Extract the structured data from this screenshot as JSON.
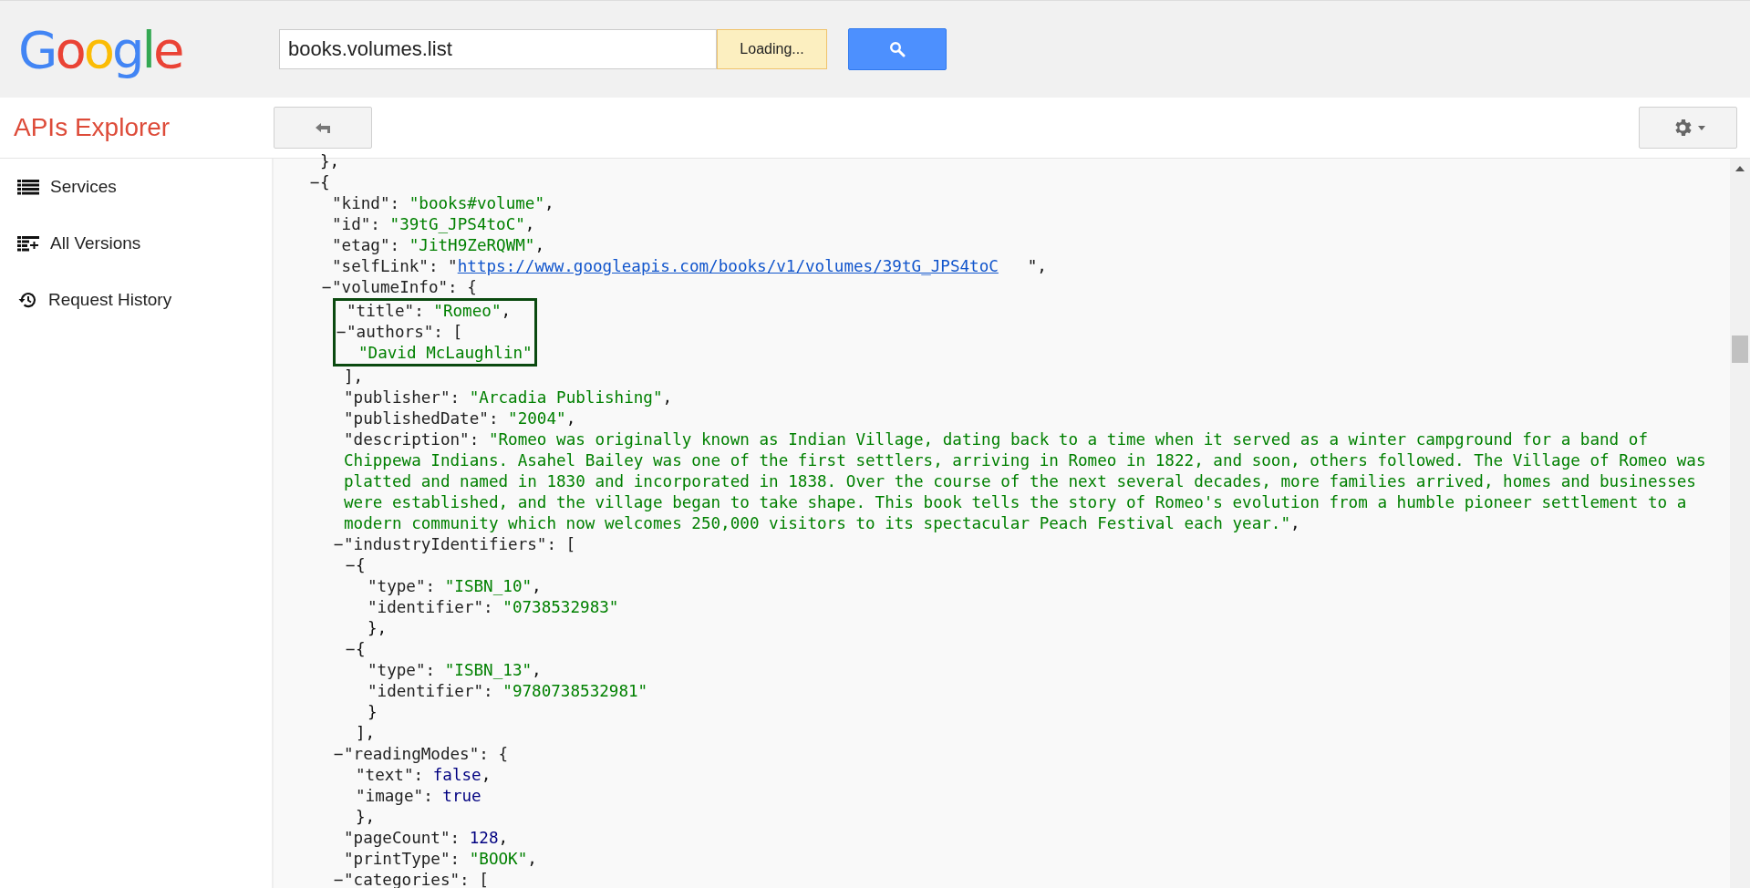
{
  "header": {
    "logo": "Google",
    "search": {
      "value": "books.volumes.list"
    },
    "status": "Loading..."
  },
  "toolbar": {
    "title": "APIs Explorer"
  },
  "sidebar": {
    "items": [
      {
        "label": "Services",
        "kind": "list"
      },
      {
        "label": "All Versions",
        "kind": "versions"
      },
      {
        "label": "Request History",
        "kind": "history"
      }
    ]
  },
  "code": [
    {
      "kind": "line",
      "tokens": [
        {
          "kind": "punct",
          "text": "},"
        }
      ]
    },
    {
      "kind": "line",
      "toggle": "−",
      "tokens": [
        {
          "kind": "punct",
          "text": "{"
        }
      ],
      "children": [
        {
          "kind": "line",
          "tokens": [
            {
              "kind": "key",
              "text": "\"kind\": "
            },
            {
              "kind": "string",
              "text": "\"books#volume\""
            },
            {
              "kind": "punct",
              "text": ","
            }
          ]
        },
        {
          "kind": "line",
          "tokens": [
            {
              "kind": "key",
              "text": "\"id\": "
            },
            {
              "kind": "string",
              "text": "\"39tG_JPS4toC\""
            },
            {
              "kind": "punct",
              "text": ","
            }
          ]
        },
        {
          "kind": "line",
          "tokens": [
            {
              "kind": "key",
              "text": "\"etag\": "
            },
            {
              "kind": "string",
              "text": "\"JitH9ZeRQWM\""
            },
            {
              "kind": "punct",
              "text": ","
            }
          ]
        },
        {
          "kind": "line",
          "tokens": [
            {
              "kind": "key",
              "text": "\"selfLink\": \""
            },
            {
              "kind": "link",
              "text": "https://www.googleapis.com/books/v1/volumes/39tG_JPS4toC"
            },
            {
              "kind": "punct",
              "text": "   \","
            }
          ]
        },
        {
          "kind": "line",
          "toggle": "−",
          "tokens": [
            {
              "kind": "key",
              "text": "\"volumeInfo\": {"
            }
          ],
          "children": [
            {
              "kind": "highlight",
              "children": [
                {
                  "kind": "line",
                  "tokens": [
                    {
                      "kind": "key",
                      "text": "\"title\": "
                    },
                    {
                      "kind": "string",
                      "text": "\"Romeo\""
                    },
                    {
                      "kind": "punct",
                      "text": ","
                    }
                  ]
                },
                {
                  "kind": "line",
                  "toggle": "−",
                  "tokens": [
                    {
                      "kind": "key",
                      "text": "\"authors\": ["
                    }
                  ],
                  "children": [
                    {
                      "kind": "line",
                      "tokens": [
                        {
                          "kind": "string",
                          "text": "\"David McLaughlin\""
                        }
                      ]
                    }
                  ]
                }
              ]
            },
            {
              "kind": "line",
              "tokens": [
                {
                  "kind": "punct",
                  "text": "],"
                }
              ]
            },
            {
              "kind": "line",
              "tokens": [
                {
                  "kind": "key",
                  "text": "\"publisher\": "
                },
                {
                  "kind": "string",
                  "text": "\"Arcadia Publishing\""
                },
                {
                  "kind": "punct",
                  "text": ","
                }
              ]
            },
            {
              "kind": "line",
              "tokens": [
                {
                  "kind": "key",
                  "text": "\"publishedDate\": "
                },
                {
                  "kind": "string",
                  "text": "\"2004\""
                },
                {
                  "kind": "punct",
                  "text": ","
                }
              ]
            },
            {
              "kind": "line",
              "tokens": [
                {
                  "kind": "key",
                  "text": "\"description\": "
                },
                {
                  "kind": "string",
                  "text": "\"Romeo was originally known as Indian Village, dating back to a time when it served as a winter campground for a band of Chippewa Indians. Asahel Bailey was one of the first settlers, arriving in Romeo in 1822, and soon, others followed. The Village of Romeo was platted and named in 1830 and incorporated in 1838. Over the course of the next several decades, more families arrived, homes and businesses were established, and the village began to take shape. This book tells the story of Romeo's evolution from a humble pioneer settlement to a modern community which now welcomes 250,000 visitors to its spectacular Peach Festival each year.\""
                },
                {
                  "kind": "punct",
                  "text": ","
                }
              ]
            },
            {
              "kind": "line",
              "toggle": "−",
              "tokens": [
                {
                  "kind": "key",
                  "text": "\"industryIdentifiers\": ["
                }
              ],
              "children": [
                {
                  "kind": "line",
                  "toggle": "−",
                  "tokens": [
                    {
                      "kind": "punct",
                      "text": "{"
                    }
                  ],
                  "children": [
                    {
                      "kind": "line",
                      "tokens": [
                        {
                          "kind": "key",
                          "text": "\"type\": "
                        },
                        {
                          "kind": "string",
                          "text": "\"ISBN_10\""
                        },
                        {
                          "kind": "punct",
                          "text": ","
                        }
                      ]
                    },
                    {
                      "kind": "line",
                      "tokens": [
                        {
                          "kind": "key",
                          "text": "\"identifier\": "
                        },
                        {
                          "kind": "string",
                          "text": "\"0738532983\""
                        }
                      ]
                    },
                    {
                      "kind": "line",
                      "tokens": [
                        {
                          "kind": "punct",
                          "text": "},"
                        }
                      ]
                    }
                  ]
                },
                {
                  "kind": "line",
                  "toggle": "−",
                  "tokens": [
                    {
                      "kind": "punct",
                      "text": "{"
                    }
                  ],
                  "children": [
                    {
                      "kind": "line",
                      "tokens": [
                        {
                          "kind": "key",
                          "text": "\"type\": "
                        },
                        {
                          "kind": "string",
                          "text": "\"ISBN_13\""
                        },
                        {
                          "kind": "punct",
                          "text": ","
                        }
                      ]
                    },
                    {
                      "kind": "line",
                      "tokens": [
                        {
                          "kind": "key",
                          "text": "\"identifier\": "
                        },
                        {
                          "kind": "string",
                          "text": "\"9780738532981\""
                        }
                      ]
                    },
                    {
                      "kind": "line",
                      "tokens": [
                        {
                          "kind": "punct",
                          "text": "}"
                        }
                      ]
                    }
                  ]
                },
                {
                  "kind": "line",
                  "tokens": [
                    {
                      "kind": "punct",
                      "text": "],"
                    }
                  ]
                }
              ]
            },
            {
              "kind": "line",
              "toggle": "−",
              "tokens": [
                {
                  "kind": "key",
                  "text": "\"readingModes\": {"
                }
              ],
              "children": [
                {
                  "kind": "line",
                  "tokens": [
                    {
                      "kind": "key",
                      "text": "\"text\": "
                    },
                    {
                      "kind": "literal",
                      "text": "false"
                    },
                    {
                      "kind": "punct",
                      "text": ","
                    }
                  ]
                },
                {
                  "kind": "line",
                  "tokens": [
                    {
                      "kind": "key",
                      "text": "\"image\": "
                    },
                    {
                      "kind": "literal",
                      "text": "true"
                    }
                  ]
                },
                {
                  "kind": "line",
                  "tokens": [
                    {
                      "kind": "punct",
                      "text": "},"
                    }
                  ]
                }
              ]
            },
            {
              "kind": "line",
              "tokens": [
                {
                  "kind": "key",
                  "text": "\"pageCount\": "
                },
                {
                  "kind": "literal",
                  "text": "128"
                },
                {
                  "kind": "punct",
                  "text": ","
                }
              ]
            },
            {
              "kind": "line",
              "tokens": [
                {
                  "kind": "key",
                  "text": "\"printType\": "
                },
                {
                  "kind": "string",
                  "text": "\"BOOK\""
                },
                {
                  "kind": "punct",
                  "text": ","
                }
              ]
            },
            {
              "kind": "line",
              "toggle": "−",
              "tokens": [
                {
                  "kind": "key",
                  "text": "\"categories\": ["
                }
              ]
            }
          ]
        }
      ]
    }
  ]
}
